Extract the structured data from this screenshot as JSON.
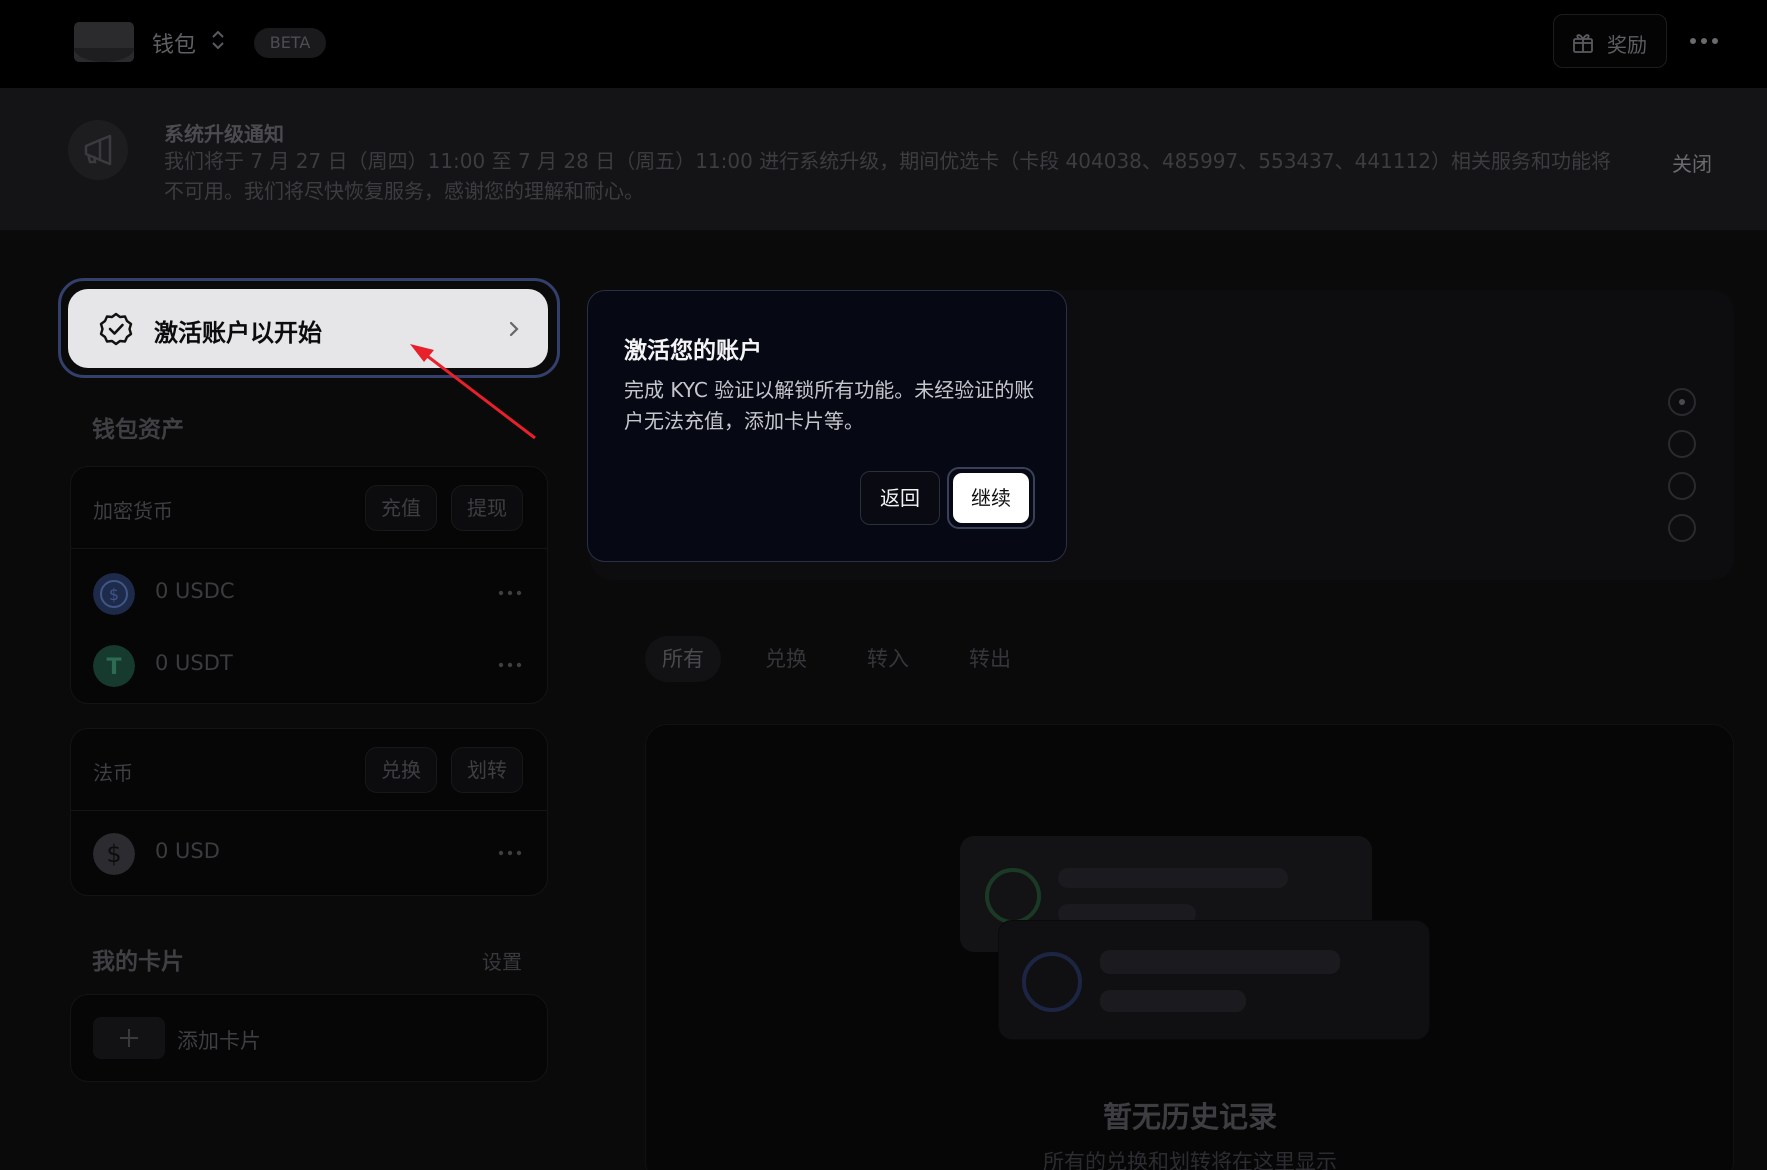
{
  "header": {
    "wallet_name": "钱包",
    "beta_label": "BETA",
    "reward_label": "奖励"
  },
  "banner": {
    "title": "系统升级通知",
    "text": "我们将于 7 月 27 日（周四）11:00 至 7 月 28 日（周五）11:00 进行系统升级，期间优选卡（卡段 404038、485997、553437、441112）相关服务和功能将不可用。我们将尽快恢复服务，感谢您的理解和耐心。",
    "close_label": "关闭"
  },
  "activate": {
    "label": "激活账户以开始"
  },
  "assets": {
    "title": "钱包资产",
    "crypto": {
      "name": "加密货币",
      "deposit_label": "充值",
      "withdraw_label": "提现",
      "items": [
        {
          "amount": "0 USDC",
          "icon": "usdc-icon",
          "color": "#2775ca"
        },
        {
          "amount": "0 USDT",
          "icon": "usdt-icon",
          "color": "#26a17b"
        }
      ]
    },
    "fiat": {
      "name": "法币",
      "exchange_label": "兑换",
      "transfer_label": "划转",
      "items": [
        {
          "amount": "0 USD",
          "icon": "dollar-icon"
        }
      ]
    }
  },
  "cards": {
    "title": "我的卡片",
    "settings_label": "设置",
    "add_label": "添加卡片"
  },
  "tabs": [
    {
      "label": "所有",
      "active": true
    },
    {
      "label": "兑换",
      "active": false
    },
    {
      "label": "转入",
      "active": false
    },
    {
      "label": "转出",
      "active": false
    }
  ],
  "history": {
    "empty_title": "暂无历史记录",
    "empty_subtitle": "所有的兑换和划转将在这里显示"
  },
  "popover": {
    "title": "激活您的账户",
    "body": "完成 KYC 验证以解锁所有功能。未经验证的账户无法充值，添加卡片等。",
    "back_label": "返回",
    "continue_label": "继续"
  },
  "colors": {
    "accent_ring": "#34406b",
    "annotation_arrow": "#e8202a"
  }
}
